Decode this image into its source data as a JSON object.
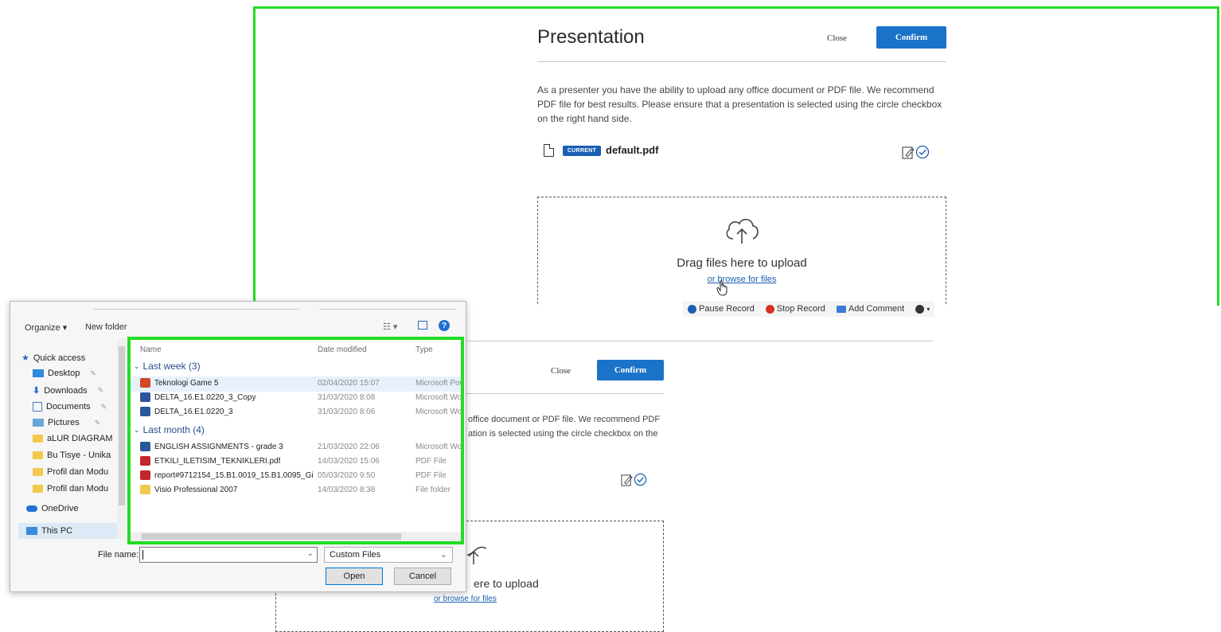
{
  "top_panel": {
    "title": "Presentation",
    "close_label": "Close",
    "confirm_label": "Confirm",
    "description": "As a presenter you have the ability to upload any office document or PDF file. We recommend PDF file for best results. Please ensure that a presentation is selected using the circle checkbox on the right hand side.",
    "current_badge": "CURRENT",
    "current_file": "default.pdf",
    "drag_text": "Drag files here to upload",
    "browse_text": "or browse for files"
  },
  "record_toolbar": {
    "pause": "Pause Record",
    "stop": "Stop Record",
    "add_comment": "Add Comment"
  },
  "bg_panel": {
    "close_label": "Close",
    "confirm_label": "Confirm",
    "desc_line1": "office document or PDF file. We recommend PDF",
    "desc_line2": "ation is selected using the circle checkbox on the",
    "drag_partial": "ere to upload",
    "browse_text": "or browse for files"
  },
  "dialog": {
    "organize": "Organize",
    "new_folder": "New folder",
    "nav": [
      "Quick access",
      "Desktop",
      "Downloads",
      "Documents",
      "Pictures",
      "aLUR DIAGRAM",
      "Bu Tisye - Unika",
      "Profil dan Modu",
      "Profil dan Modu",
      "OneDrive",
      "This PC"
    ],
    "headers": {
      "name": "Name",
      "date": "Date modified",
      "type": "Type"
    },
    "groups": [
      {
        "label": "Last week (3)",
        "files": [
          {
            "name": "Teknologi Game 5",
            "date": "02/04/2020 15:07",
            "type": "Microsoft Powe",
            "icon": "ppt"
          },
          {
            "name": "DELTA_16.E1.0220_3_Copy",
            "date": "31/03/2020 8:08",
            "type": "Microsoft Word",
            "icon": "word"
          },
          {
            "name": "DELTA_16.E1.0220_3",
            "date": "31/03/2020 8:06",
            "type": "Microsoft Word",
            "icon": "word"
          }
        ]
      },
      {
        "label": "Last month (4)",
        "files": [
          {
            "name": "ENGLISH ASSIGNMENTS - grade 3",
            "date": "21/03/2020 22:06",
            "type": "Microsoft Word",
            "icon": "word"
          },
          {
            "name": "ETKILI_ILETISIM_TEKNIKLERI.pdf",
            "date": "14/03/2020 15:06",
            "type": "PDF File",
            "icon": "pdf"
          },
          {
            "name": "report#9712154_15.B1.0019_15.B1.0095_Gi...",
            "date": "05/03/2020 9:50",
            "type": "PDF File",
            "icon": "pdf"
          },
          {
            "name": "Visio Professional 2007",
            "date": "14/03/2020 8:38",
            "type": "File folder",
            "icon": "folder"
          }
        ]
      }
    ],
    "file_name_label": "File name:",
    "file_name_value": "",
    "file_type": "Custom Files",
    "open_label": "Open",
    "cancel_label": "Cancel"
  },
  "colors": {
    "accent_green": "#22dd22",
    "confirm_blue": "#1a73c8",
    "link_blue": "#1a5fb4"
  }
}
